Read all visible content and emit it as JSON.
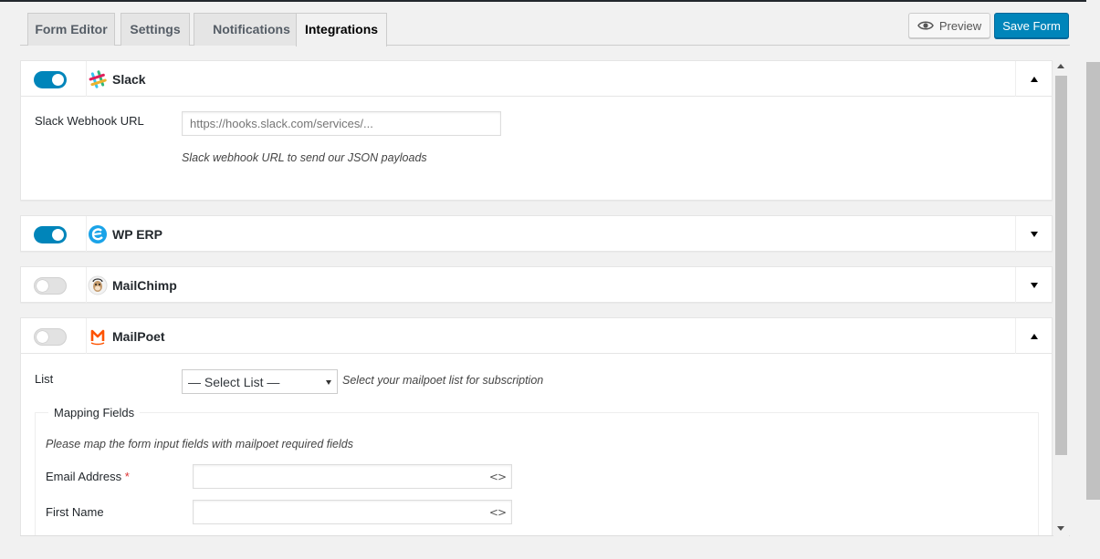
{
  "tabs": [
    {
      "label": "Form Editor",
      "active": false
    },
    {
      "label": "Settings",
      "active": false
    },
    {
      "label": "Notifications",
      "active": false
    },
    {
      "label": "Integrations",
      "active": true
    }
  ],
  "header": {
    "preview_label": "Preview",
    "preview_icon": "eye-icon",
    "save_label": "Save Form"
  },
  "colors": {
    "primary": "#0085ba",
    "toggle_off": "#e2e2e2",
    "required": "#dc3232"
  },
  "integrations": {
    "slack": {
      "title": "Slack",
      "enabled": true,
      "expanded": true,
      "webhook_label": "Slack Webhook URL",
      "webhook_placeholder": "https://hooks.slack.com/services/...",
      "webhook_help": "Slack webhook URL to send our JSON payloads"
    },
    "wperp": {
      "title": "WP ERP",
      "enabled": true,
      "expanded": false
    },
    "mailchimp": {
      "title": "MailChimp",
      "enabled": false,
      "expanded": false
    },
    "mailpoet": {
      "title": "MailPoet",
      "enabled": false,
      "expanded": true,
      "list_label": "List",
      "list_selected": "— Select List —",
      "list_help": "Select your mailpoet list for subscription",
      "mapping_legend": "Mapping Fields",
      "mapping_help": "Please map the form input fields with mailpoet required fields",
      "email_label": "Email Address",
      "required_mark": "*",
      "first_name_label": "First Name",
      "merge_icon_glyph": "<>"
    }
  }
}
